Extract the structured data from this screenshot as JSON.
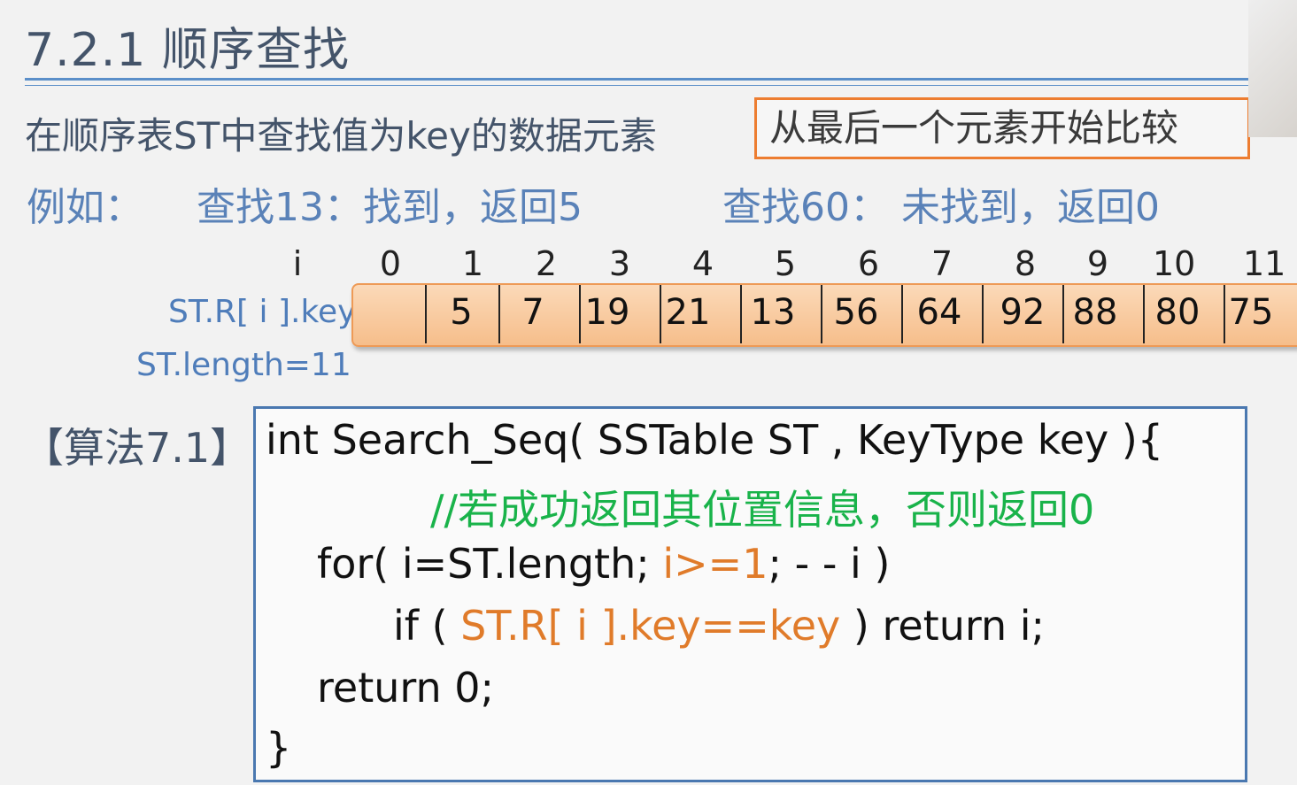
{
  "title": "7.2.1 顺序查找",
  "intro": "在顺序表ST中查找值为key的数据元素",
  "hint": "从最后一个元素开始比较",
  "example": {
    "label": "例如：",
    "case1": "查找13：找到，返回5",
    "case2": "查找60： 未找到，返回0"
  },
  "table": {
    "index_label": "i",
    "key_label": "ST.R[ i ].key",
    "length_label": "ST.length=11",
    "indices": [
      "0",
      "1",
      "2",
      "3",
      "4",
      "5",
      "6",
      "7",
      "8",
      "9",
      "10",
      "11"
    ],
    "keys": [
      "",
      "5",
      "7",
      "19",
      "21",
      "13",
      "56",
      "64",
      "92",
      "88",
      "80",
      "75"
    ]
  },
  "algorithm": {
    "label": "【算法7.1】",
    "line1": "int Search_Seq( SSTable  ST , KeyType  key ){",
    "comment": "//若成功返回其位置信息，否则返回0",
    "for_a": "for( i=ST.length;  ",
    "for_b": "i>=1",
    "for_c": ";   - - i  )",
    "if_a": "if  ( ",
    "if_b": "ST.R[ i ].key==key",
    "if_c": " )   return i;",
    "ret": "return 0;",
    "close": "}"
  },
  "colors": {
    "accent": "#5b8fc9",
    "highlight": "#ed7d31",
    "comment": "#19b34a"
  }
}
